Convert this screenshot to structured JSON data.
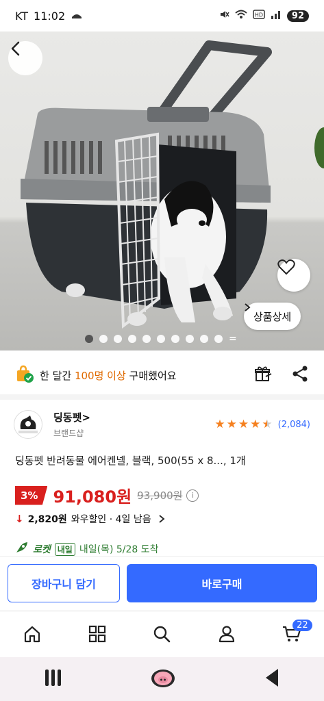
{
  "status_bar": {
    "carrier": "KT",
    "time": "11:02",
    "battery": "92"
  },
  "hero": {
    "detail_button": "상품상세",
    "image_count": 10,
    "active_index": 0
  },
  "purchase_info": {
    "prefix": "한 달간",
    "highlight": "100명 이상",
    "suffix": "구매했어요"
  },
  "brand": {
    "name": "딩동펫",
    "chevron": ">",
    "subtitle": "브랜드샵",
    "rating": 4.5,
    "review_count": "(2,084)"
  },
  "product": {
    "title": "딩동펫 반려동물 에어켄넬, 블랙, 500(55 x 8..., 1개"
  },
  "price": {
    "discount": "3%",
    "sale_price": "91,080원",
    "original_price": "93,900원"
  },
  "wow": {
    "amount": "2,820원",
    "text": "와우할인 · 4일 남음"
  },
  "delivery": {
    "rocket": "로켓",
    "badge": "내일",
    "arrival": "내일(목) 5/28 도착"
  },
  "actions": {
    "cart_label": "장바구니 담기",
    "buy_label": "바로구매"
  },
  "bottom_nav": {
    "cart_count": "22"
  },
  "colors": {
    "accent": "#346aff",
    "price_red": "#d9201e",
    "rocket_green": "#2f7d32",
    "star_orange": "#f5801f"
  }
}
